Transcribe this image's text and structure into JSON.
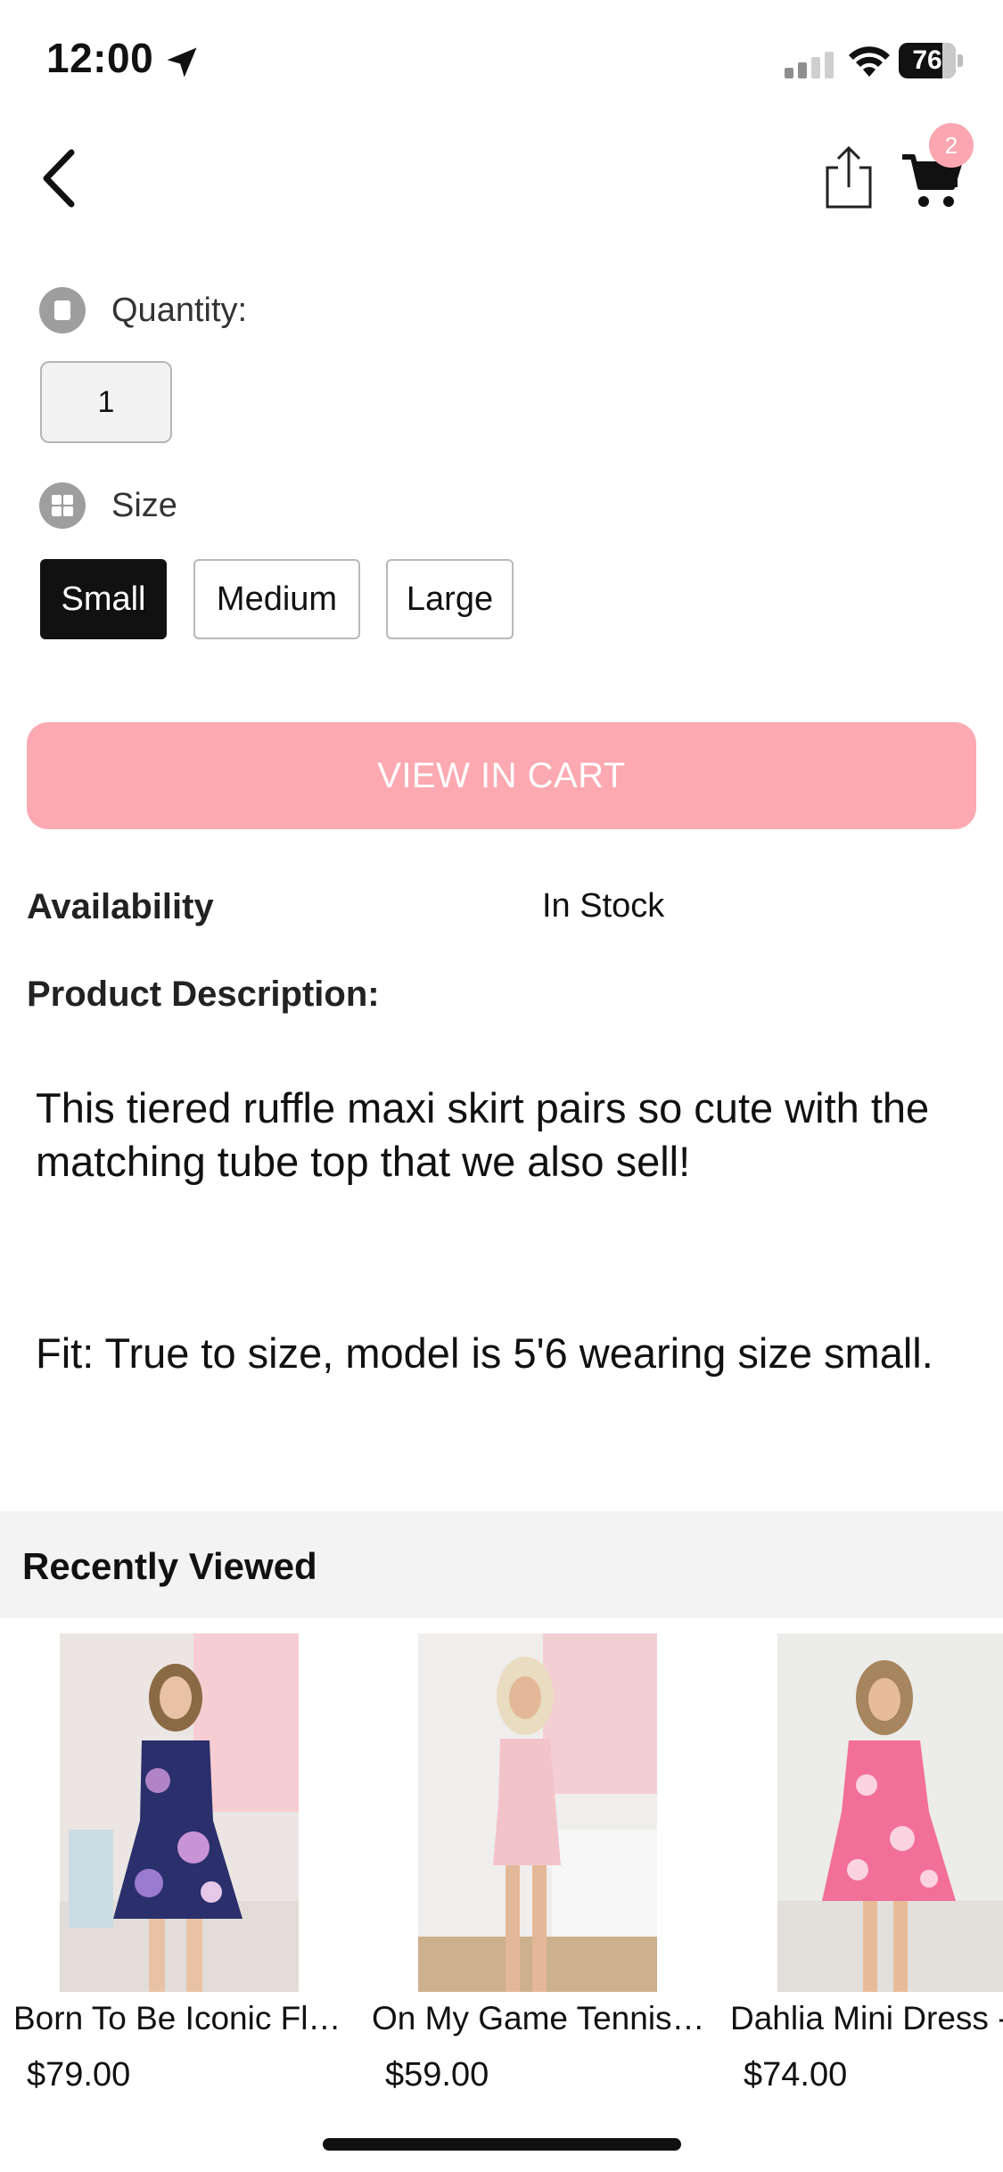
{
  "status_bar": {
    "time": "12:00",
    "battery": "76",
    "battery_level": 0.76
  },
  "nav": {
    "cart_count": "2"
  },
  "quantity": {
    "label": "Quantity:",
    "value": "1"
  },
  "size": {
    "label": "Size",
    "options": [
      "Small",
      "Medium",
      "Large"
    ],
    "selected": "Small"
  },
  "cta": {
    "label": "VIEW IN CART",
    "color": "#fca9b1"
  },
  "availability": {
    "label": "Availability",
    "value": "In Stock"
  },
  "description": {
    "title": "Product Description:",
    "paragraphs": [
      "This tiered ruffle maxi skirt pairs so cute with the matching tube top that we also sell!",
      "Fit: True to size, model is 5'6 wearing size small."
    ]
  },
  "recently_viewed": {
    "title": "Recently Viewed",
    "items": [
      {
        "name": "Born To Be Iconic Fl…",
        "price": "$79.00"
      },
      {
        "name": "On My Game Tennis…",
        "price": "$59.00"
      },
      {
        "name": "Dahlia Mini Dress -",
        "price": "$74.00"
      }
    ]
  }
}
